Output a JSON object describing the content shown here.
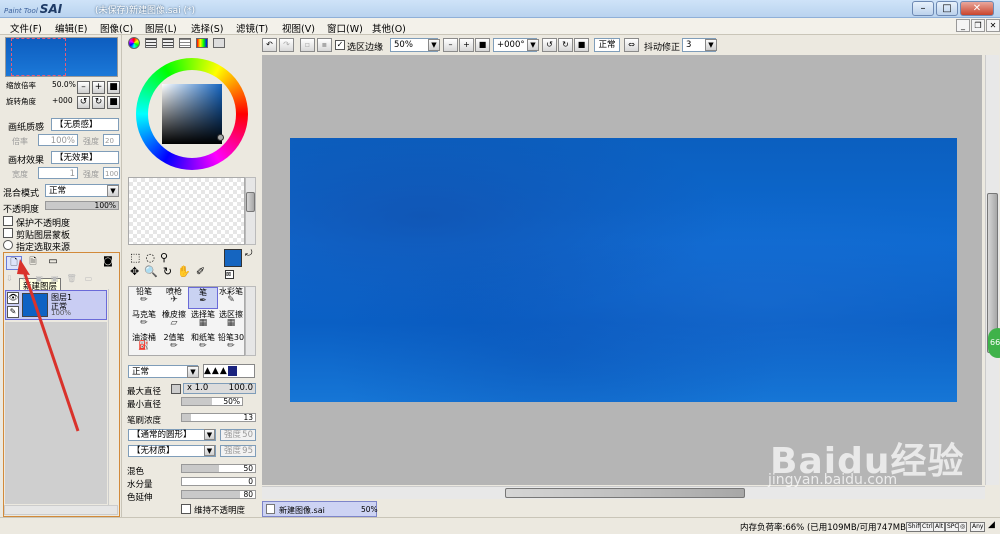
{
  "window": {
    "app_logo_small": "Paint Tool",
    "app_logo": "SAI",
    "title": "(未保存)新建图像.sai (*)",
    "min": "–",
    "max": "□",
    "close": "✕"
  },
  "menu": [
    "文件(F)",
    "编辑(E)",
    "图像(C)",
    "图层(L)",
    "选择(S)",
    "滤镜(T)",
    "视图(V)",
    "窗口(W)",
    "其他(O)"
  ],
  "toolbar": {
    "selection_edge_label": "选区边缘",
    "zoom_value": "50%",
    "rotate_value": "+000°",
    "mode_label": "正常",
    "stabilizer_label": "抖动修正",
    "stabilizer_value": "3"
  },
  "navigator": {
    "zoom_label": "缩放倍率",
    "zoom_value": "50.0%",
    "rotate_label": "旋转角度",
    "rotate_value": "+000"
  },
  "paper": {
    "texture_label": "画纸质感",
    "texture_value": "【无质感】",
    "scale_label": "倍率",
    "scale_value": "100%",
    "strength_label": "强度",
    "strength_value": "20",
    "effect_label": "画材效果",
    "effect_value": "【无效果】",
    "width_label": "宽度",
    "width_value": "1",
    "strength2_value": "100"
  },
  "layer": {
    "blend_label": "混合模式",
    "blend_value": "正常",
    "opacity_label": "不透明度",
    "opacity_value": "100%",
    "opacity_level": 1.0,
    "preserve_opacity": "保护不透明度",
    "clipping": "剪贴图层蒙板",
    "selection_source": "指定选取来源",
    "tooltip": "新建图层",
    "name": "图层1",
    "mode": "正常",
    "percent": "100%"
  },
  "brushes": [
    {
      "name": "铅笔"
    },
    {
      "name": "喷枪"
    },
    {
      "name": "笔"
    },
    {
      "name": "水彩笔"
    },
    {
      "name": "马克笔"
    },
    {
      "name": "橡皮擦"
    },
    {
      "name": "选择笔"
    },
    {
      "name": "选区擦"
    },
    {
      "name": "油漆桶"
    },
    {
      "name": "2值笔"
    },
    {
      "name": "和纸笔"
    },
    {
      "name": "铅笔30"
    }
  ],
  "brush_settings": {
    "mode": "正常",
    "max_size_label": "最大直径",
    "max_size_mult": "x 1.0",
    "max_size_value": "100.0",
    "min_size_label": "最小直径",
    "min_size_value": "50%",
    "min_size_level": 0.5,
    "density_label": "笔刷浓度",
    "density_value": "13",
    "density_level": 0.13,
    "shape_value": "【通常的圆形】",
    "shape_strength_label": "强度",
    "shape_strength_value": "50",
    "texture_value": "【无材质】",
    "texture_strength_label": "强度",
    "texture_strength_value": "95",
    "blend_label": "混色",
    "blend_value": "50",
    "blend_level": 0.5,
    "dilution_label": "水分量",
    "dilution_value": "0",
    "dilution_level": 0,
    "persistence_label": "色延伸",
    "persistence_value": "80",
    "persistence_level": 0.8,
    "keep_opacity_label": "维持不透明度"
  },
  "document_tab": {
    "name": "新建图像.sai",
    "zoom": "50%"
  },
  "status": {
    "memory": "内存负荷率:66% (已用109MB/可用747MB)",
    "keys": [
      "Shift",
      "Ctrl",
      "Alt",
      "SPC",
      "◎",
      "Any"
    ]
  },
  "watermark": {
    "brand": "Baidu经验",
    "url": "jingyan.baidu.com"
  },
  "side_badge": "66",
  "colors": {
    "canvas_blue": "#0b62c6",
    "primary_color": "#1565c0",
    "accent_red": "#d9322b"
  }
}
